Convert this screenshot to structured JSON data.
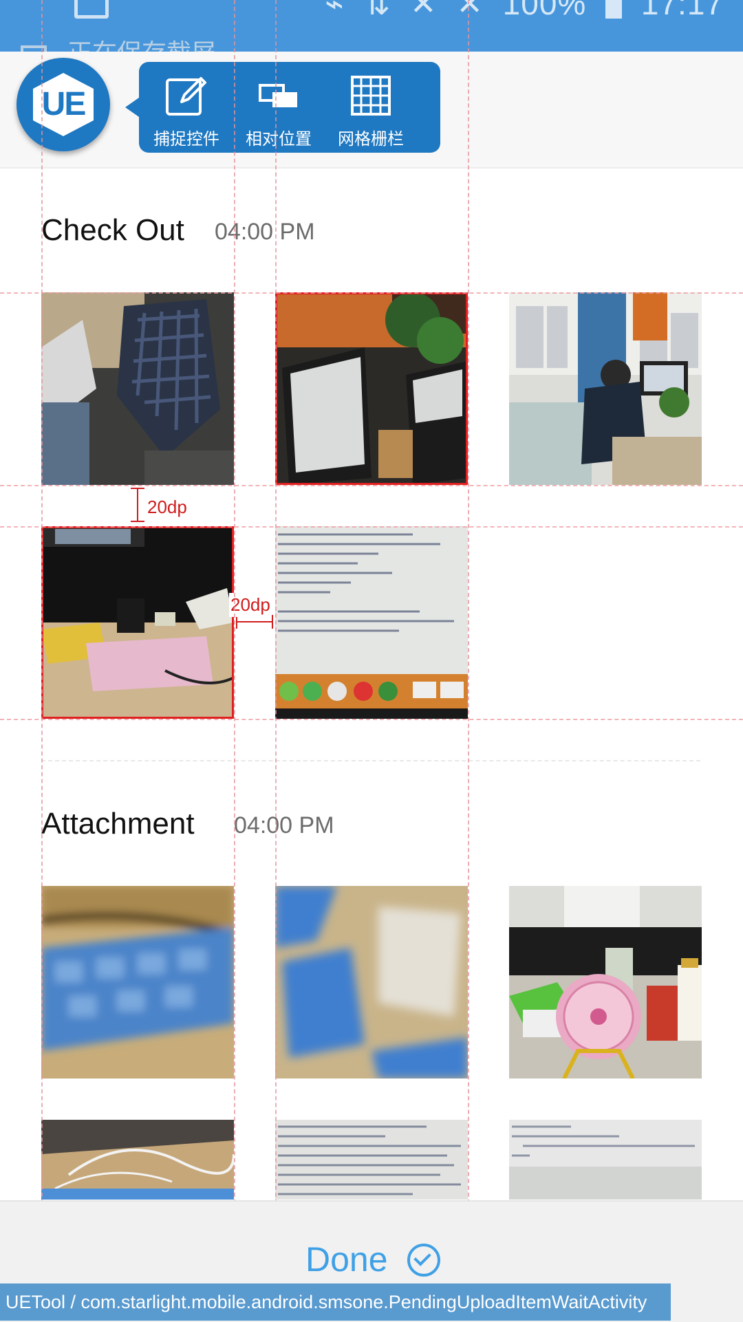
{
  "status_bar": {
    "battery_percent": "100%",
    "time": "17:17",
    "icons": [
      "gallery-icon",
      "nfc-icon",
      "data-icon",
      "signal-off-icon",
      "signal-off-icon",
      "battery-icon"
    ],
    "notification_text": "正在保存截屏"
  },
  "uetool": {
    "logo_text": "UE",
    "tools": [
      {
        "icon": "pencil-icon",
        "label": "捕捉控件"
      },
      {
        "icon": "overlap-icon",
        "label": "相对位置"
      },
      {
        "icon": "grid-icon",
        "label": "网格栅栏"
      }
    ],
    "measure_vertical": "20dp",
    "measure_horizontal": "20dp",
    "guide_color": "#e4949c",
    "highlight_color": "#e02020",
    "info_text": "UETool / com.starlight.mobile.android.smsone.PendingUploadItemWaitActivity"
  },
  "sections": [
    {
      "title": "Check Out",
      "time": "04:00 PM",
      "photos": [
        "photo-basket",
        "photo-monitors-plant",
        "photo-office-desk",
        "photo-desk-food",
        "photo-code-screen"
      ]
    },
    {
      "title": "Attachment",
      "time": "04:00 PM",
      "photos": [
        "photo-blue-keyboard",
        "photo-keyboard-closeup",
        "photo-desk-fan",
        "photo-cable-keyboard",
        "photo-code-screen-2",
        "photo-code-screen-3"
      ]
    }
  ],
  "footer": {
    "done_label": "Done"
  },
  "colors": {
    "status_bar": "#4796db",
    "brand_blue": "#1e78c2",
    "done_blue": "#3fa0e6"
  }
}
